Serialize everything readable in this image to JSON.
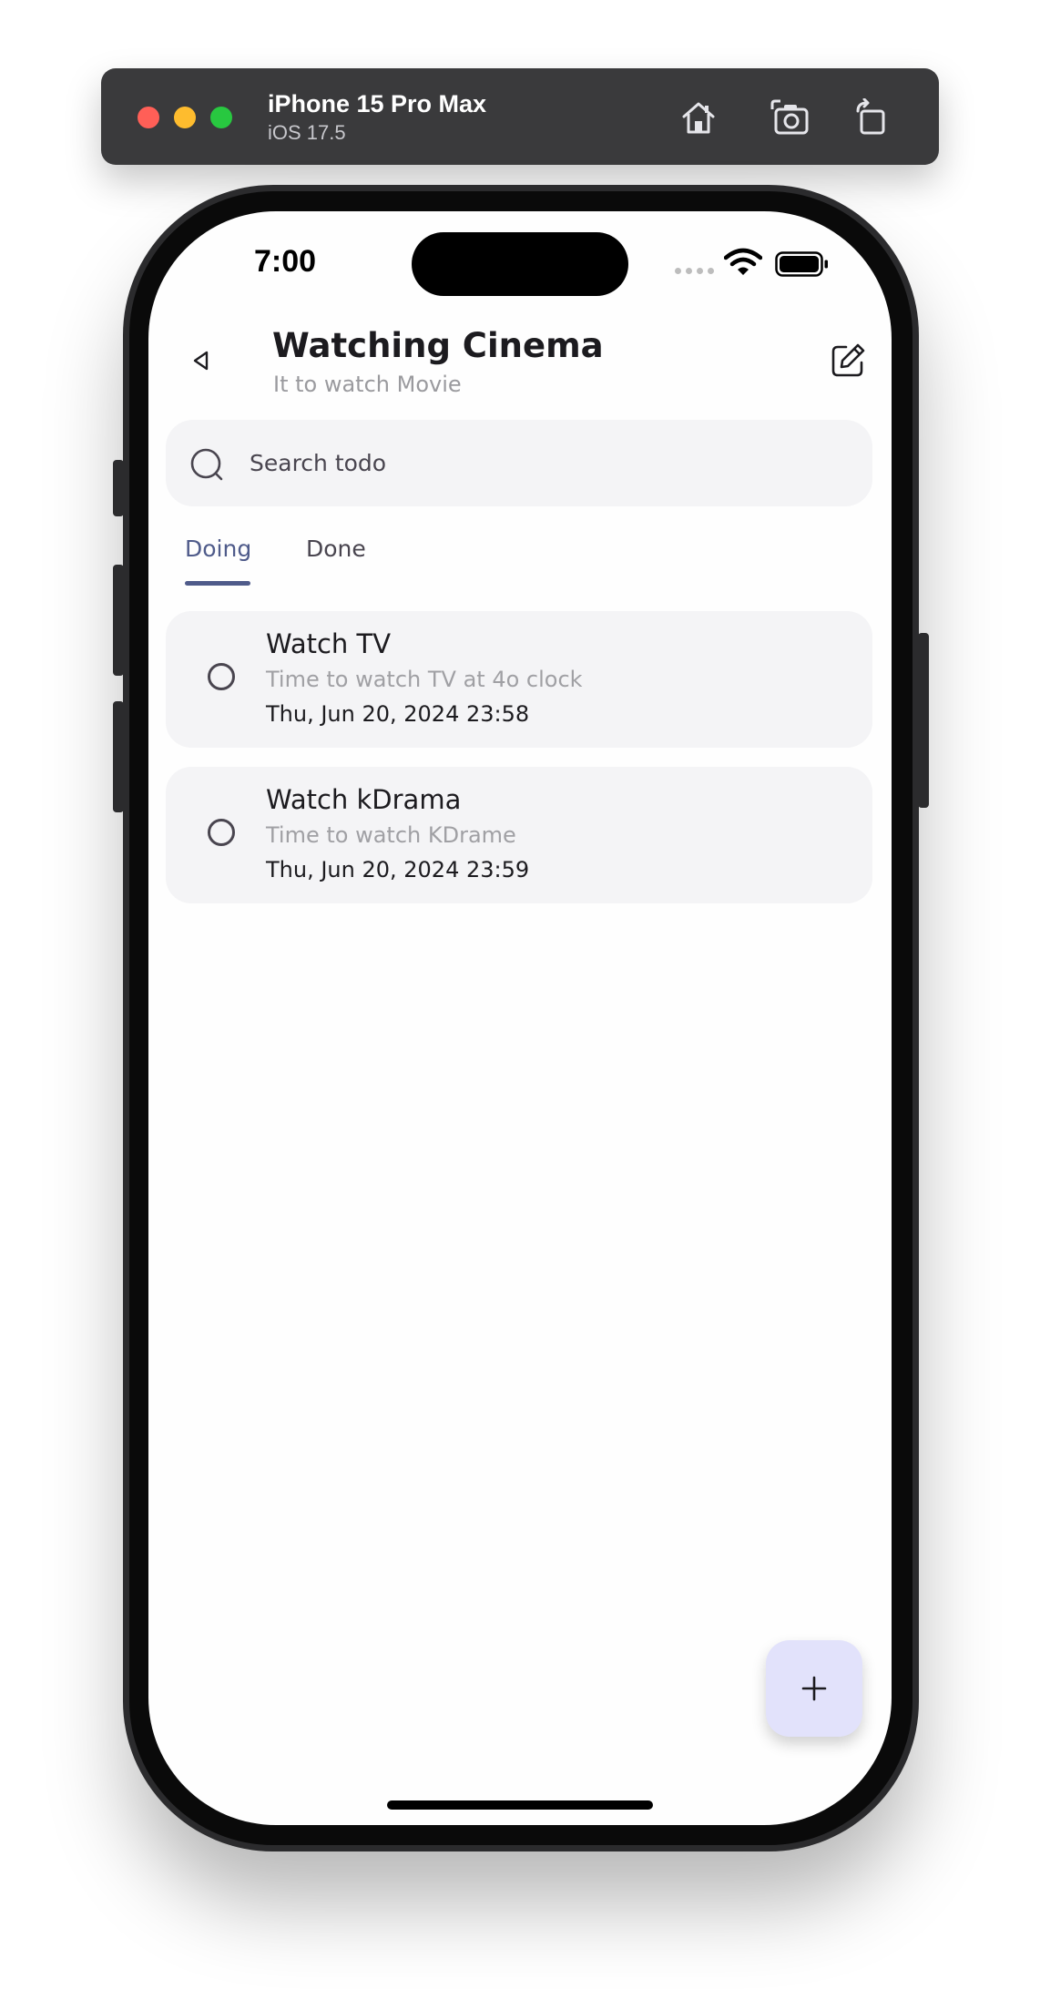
{
  "simulator": {
    "device_name": "iPhone 15 Pro Max",
    "os_version": "iOS 17.5",
    "icons": [
      "home-icon",
      "screenshot-icon",
      "rotate-icon"
    ]
  },
  "status_bar": {
    "time": "7:00",
    "icons": [
      "cellular-icon",
      "wifi-icon",
      "battery-icon"
    ]
  },
  "header": {
    "title": "Watching Cinema",
    "subtitle": "It to watch Movie",
    "back_icon": "back-triangle-icon",
    "edit_icon": "edit-icon"
  },
  "search": {
    "placeholder": "Search todo",
    "value": ""
  },
  "tabs": [
    {
      "label": "Doing",
      "selected": true
    },
    {
      "label": "Done",
      "selected": false
    }
  ],
  "todos": [
    {
      "title": "Watch TV",
      "description": "Time to watch TV at 4o clock",
      "date": "Thu, Jun 20, 2024 23:58",
      "done": false
    },
    {
      "title": "Watch kDrama",
      "description": "Time to watch KDrame",
      "date": "Thu, Jun 20, 2024 23:59",
      "done": false
    }
  ],
  "fab": {
    "icon": "plus-icon"
  },
  "colors": {
    "accent": "#4f5b8a",
    "card_background": "#f4f4f6",
    "fab_background": "#e2e2fb",
    "secondary_text": "#9a9a9e"
  }
}
